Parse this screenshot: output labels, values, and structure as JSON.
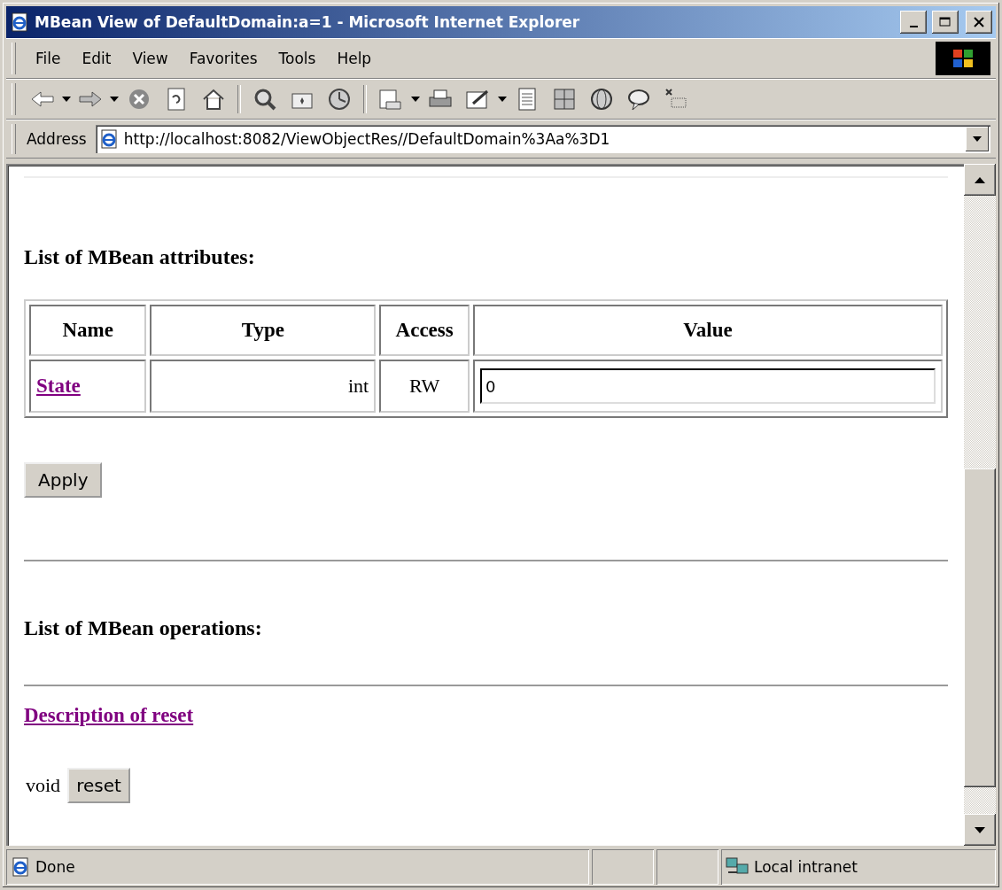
{
  "window": {
    "title": "MBean View of DefaultDomain:a=1 - Microsoft Internet Explorer"
  },
  "menu": [
    "File",
    "Edit",
    "View",
    "Favorites",
    "Tools",
    "Help"
  ],
  "address": {
    "label": "Address",
    "value": "http://localhost:8082/ViewObjectRes//DefaultDomain%3Aa%3D1"
  },
  "page": {
    "attributes_heading": "List of MBean attributes:",
    "table": {
      "columns": [
        "Name",
        "Type",
        "Access",
        "Value"
      ],
      "rows": [
        {
          "name": "State",
          "type": "int",
          "access": "RW",
          "value": "0"
        }
      ]
    },
    "apply_button": "Apply",
    "operations_heading": "List of MBean operations:",
    "operations": [
      {
        "description": "Description of reset",
        "return_type": "void",
        "button": "reset"
      }
    ]
  },
  "status_bar": {
    "text": "Done",
    "zone": "Local intranet"
  }
}
